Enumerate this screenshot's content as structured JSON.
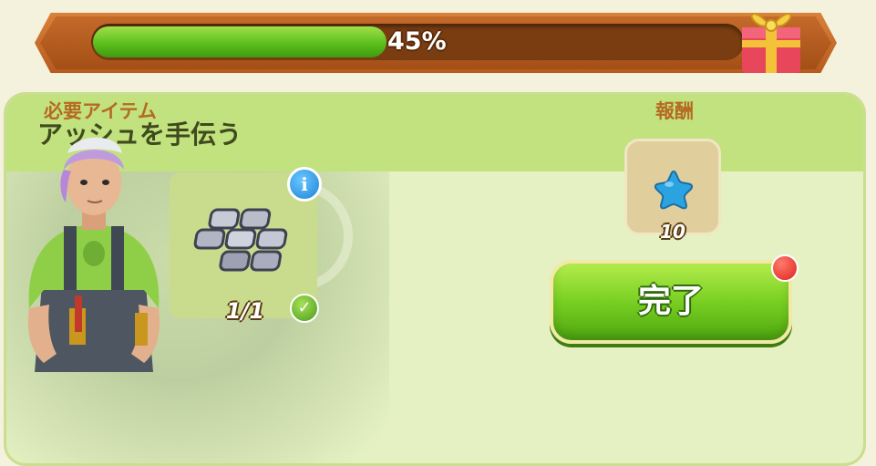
{
  "progress": {
    "percent_value": 45,
    "label": "45%"
  },
  "quest": {
    "title": "アッシュを手伝う",
    "requirements_label": "必要アイテム",
    "required_item": {
      "icon": "stone-tiles-icon",
      "count_label": "1/1",
      "info_label": "i",
      "complete_mark": "✓"
    },
    "rewards_label": "報酬",
    "reward": {
      "icon": "blue-star-icon",
      "amount_label": "10"
    },
    "complete_button_label": "完了"
  },
  "colors": {
    "progress_fill": "#5cbf1d",
    "panel_bg": "#e5f1c2",
    "panel_header": "#c2e17f",
    "section_label": "#b56a22",
    "button_green": "#79cf22",
    "notification_red": "#e0231a",
    "star_blue": "#2aa3e0"
  }
}
